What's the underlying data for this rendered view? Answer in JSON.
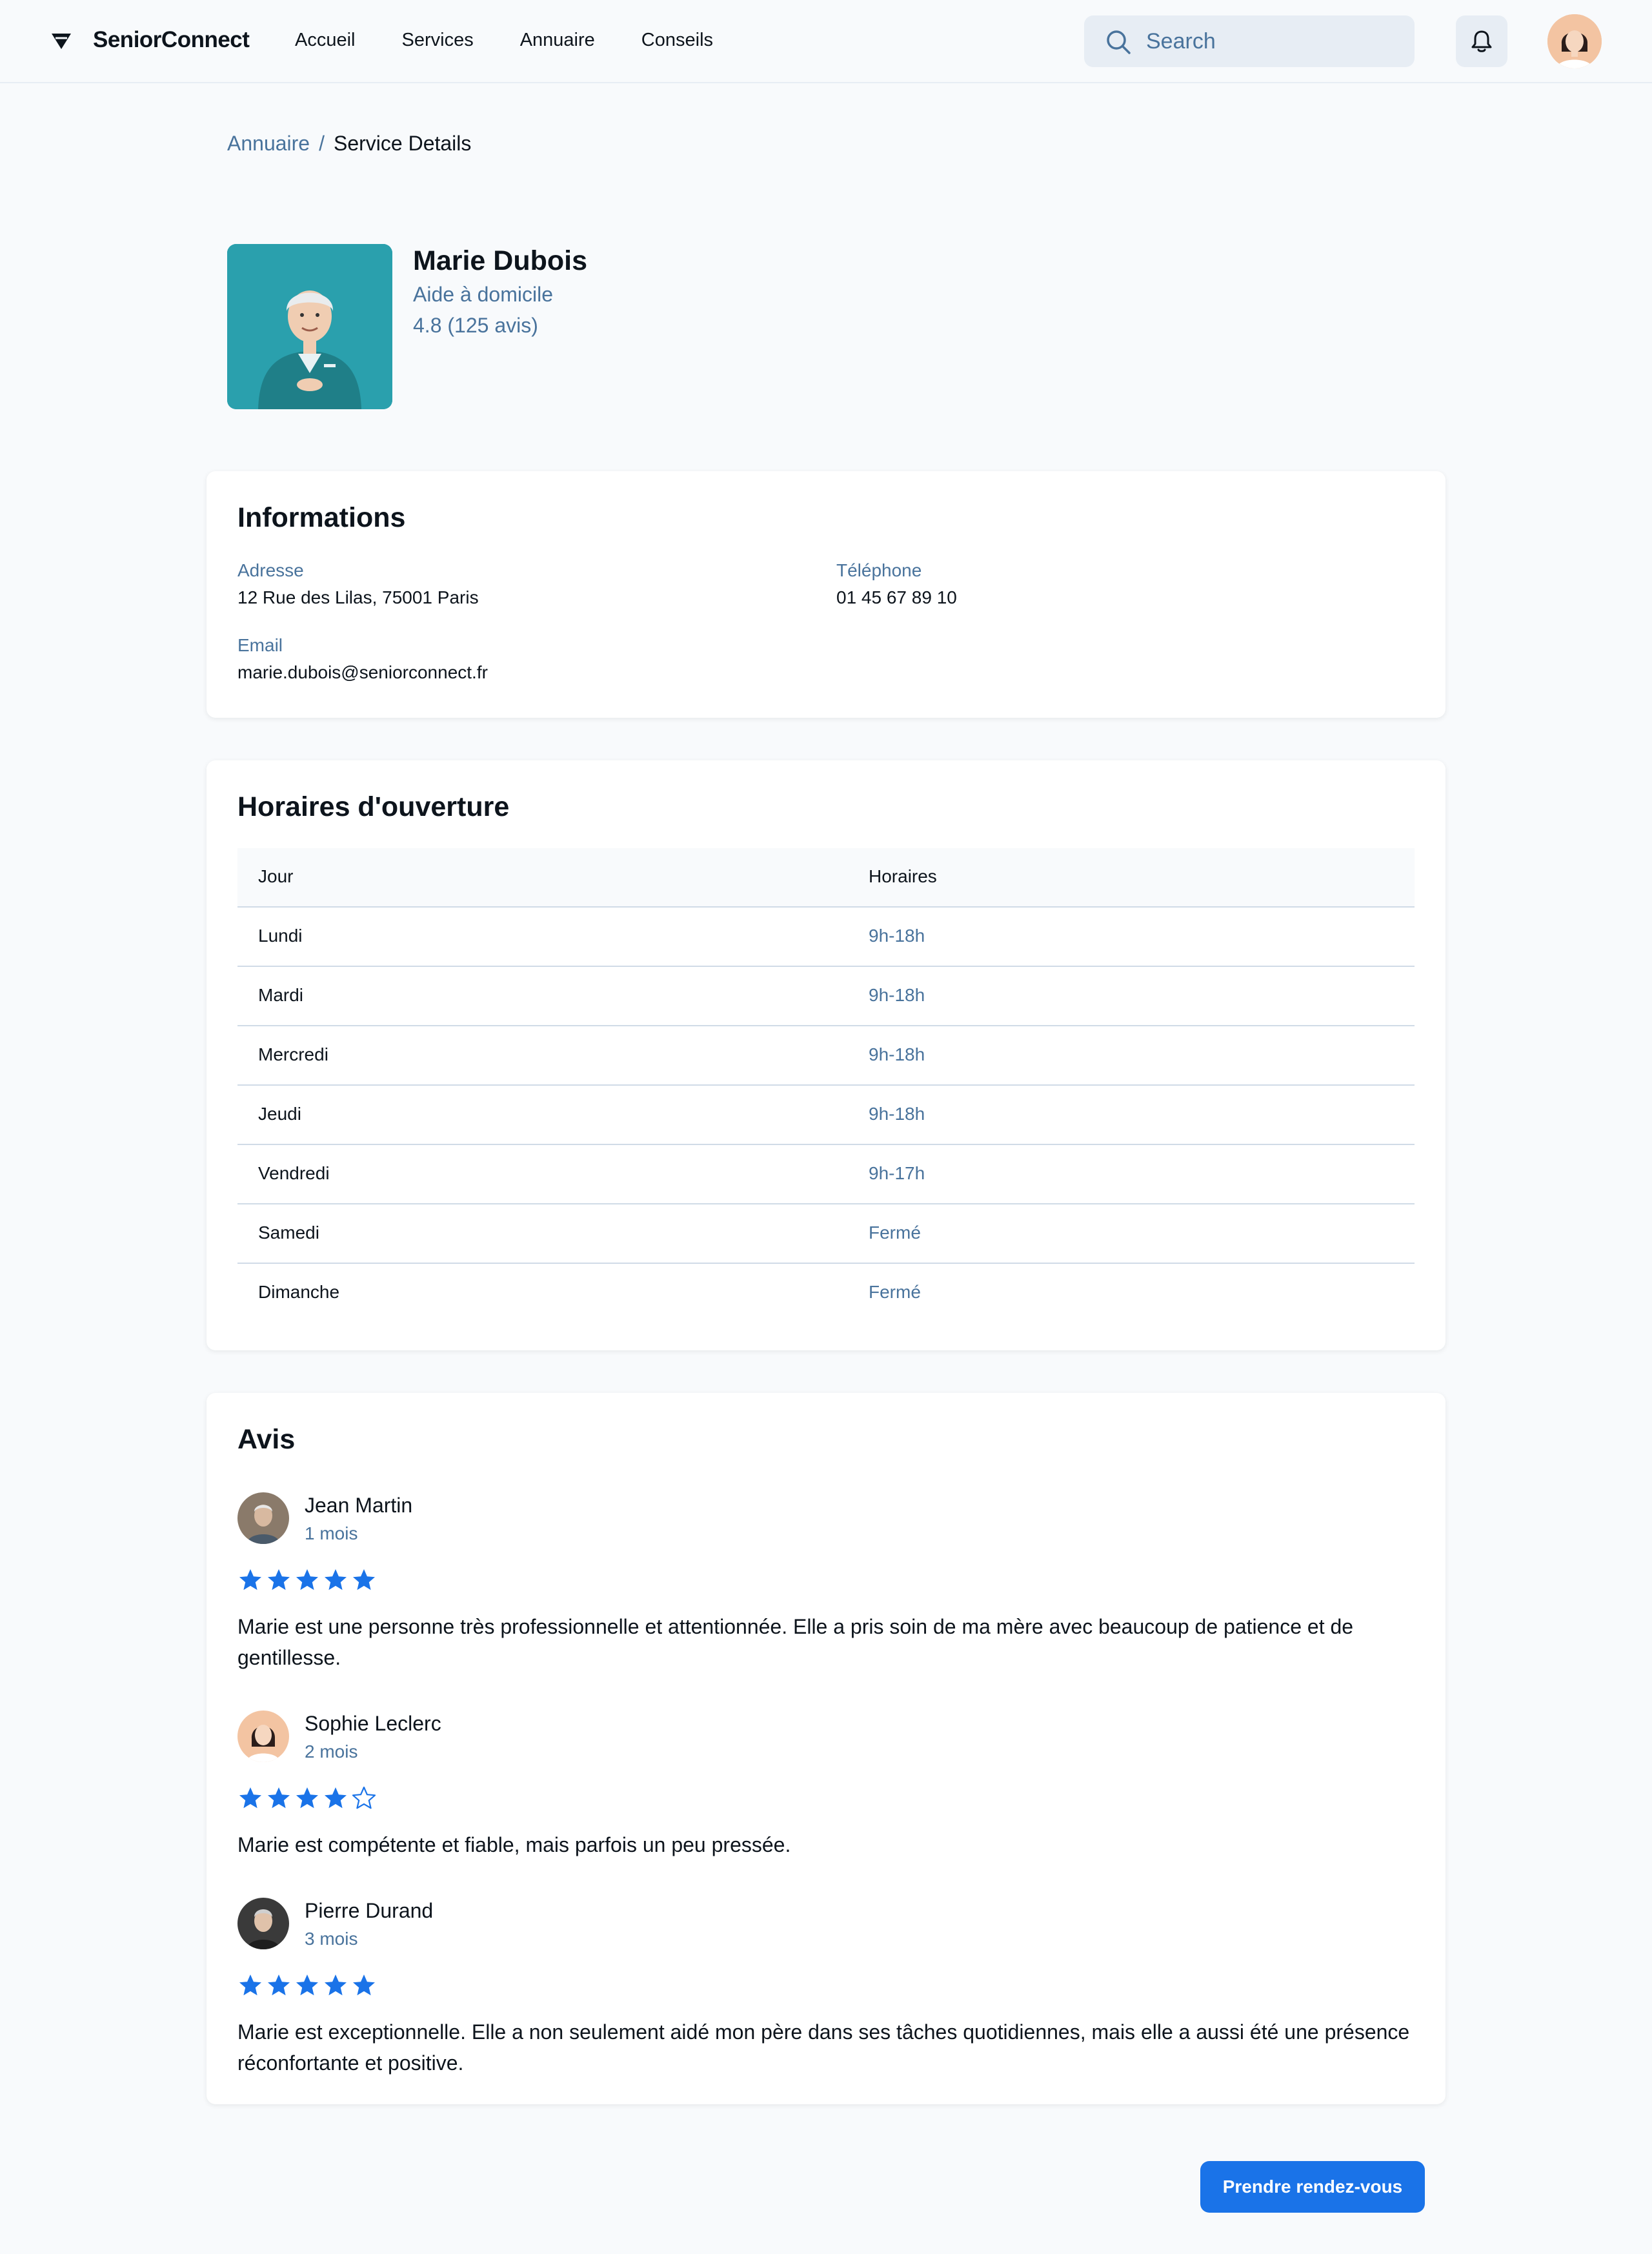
{
  "app": {
    "brand": "SeniorConnect"
  },
  "nav": {
    "items": [
      "Accueil",
      "Services",
      "Annuaire",
      "Conseils"
    ]
  },
  "search": {
    "placeholder": "Search"
  },
  "breadcrumb": {
    "parent": "Annuaire",
    "separator": "/",
    "current": "Service Details"
  },
  "profile": {
    "name": "Marie Dubois",
    "role": "Aide à domicile",
    "rating": "4.8 (125 avis)"
  },
  "info": {
    "title": "Informations",
    "address_label": "Adresse",
    "address": "12 Rue des Lilas, 75001 Paris",
    "phone_label": "Téléphone",
    "phone": "01 45 67 89 10",
    "email_label": "Email",
    "email": "marie.dubois@seniorconnect.fr"
  },
  "hours": {
    "title": "Horaires d'ouverture",
    "col_day": "Jour",
    "col_hours": "Horaires",
    "rows": [
      {
        "day": "Lundi",
        "hours": "9h-18h"
      },
      {
        "day": "Mardi",
        "hours": "9h-18h"
      },
      {
        "day": "Mercredi",
        "hours": "9h-18h"
      },
      {
        "day": "Jeudi",
        "hours": "9h-18h"
      },
      {
        "day": "Vendredi",
        "hours": "9h-17h"
      },
      {
        "day": "Samedi",
        "hours": "Fermé"
      },
      {
        "day": "Dimanche",
        "hours": "Fermé"
      }
    ]
  },
  "reviews": {
    "title": "Avis",
    "items": [
      {
        "name": "Jean Martin",
        "date": "1 mois",
        "stars": 5,
        "text": "Marie est une personne très professionnelle et attentionnée. Elle a pris soin de ma mère avec beaucoup de patience et de gentillesse."
      },
      {
        "name": "Sophie Leclerc",
        "date": "2 mois",
        "stars": 4,
        "text": "Marie est compétente et fiable, mais parfois un peu pressée."
      },
      {
        "name": "Pierre Durand",
        "date": "3 mois",
        "stars": 5,
        "text": "Marie est exceptionnelle. Elle a non seulement aidé mon père dans ses tâches quotidiennes, mais elle a aussi été une présence réconfortante et positive."
      }
    ]
  },
  "cta": {
    "label": "Prendre rendez-vous"
  },
  "colors": {
    "accent": "#1a73e8",
    "muted": "#49739c",
    "text": "#0d141c",
    "surface": "#e7edf4",
    "background": "#f8fafc"
  },
  "icons": {
    "logo": "logo-icon",
    "search": "search-icon",
    "bell": "bell-icon",
    "star": "star-icon"
  }
}
